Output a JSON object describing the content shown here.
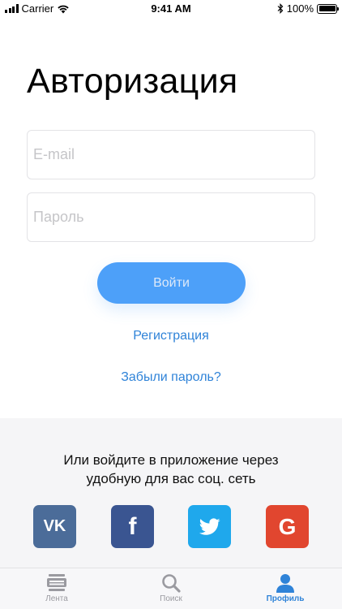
{
  "status_bar": {
    "carrier": "Carrier",
    "time": "9:41 AM",
    "battery": "100%"
  },
  "auth": {
    "title": "Авторизация",
    "email_placeholder": "E-mail",
    "password_placeholder": "Пароль",
    "login_label": "Войти",
    "register_label": "Регистрация",
    "forgot_label": "Забыли пароль?"
  },
  "social": {
    "caption_line1": "Или войдите в приложение через",
    "caption_line2": "удобную для вас соц. сеть",
    "buttons": [
      {
        "icon": "vk-icon",
        "glyph": "VK",
        "color": "#4b6c99"
      },
      {
        "icon": "facebook-icon",
        "glyph": "f",
        "color": "#3a5591"
      },
      {
        "icon": "twitter-icon",
        "glyph": "",
        "color": "#1fa8ec"
      },
      {
        "icon": "google-icon",
        "glyph": "G",
        "color": "#e1462f"
      }
    ]
  },
  "tab_bar": {
    "tabs": [
      {
        "label": "Лента",
        "icon": "feed-icon",
        "active": false
      },
      {
        "label": "Поиск",
        "icon": "search-icon",
        "active": false
      },
      {
        "label": "Профиль",
        "icon": "profile-icon",
        "active": true
      }
    ],
    "active_color": "#2f83d8",
    "inactive_color": "#9a9aa0"
  },
  "colors": {
    "primary": "#4da0f9",
    "link": "#2f83d8"
  }
}
